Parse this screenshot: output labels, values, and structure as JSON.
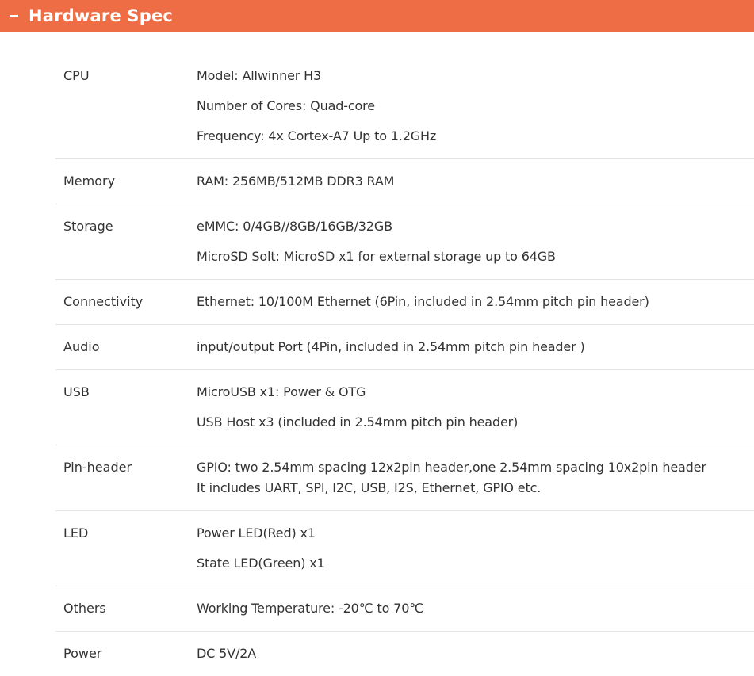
{
  "header": {
    "title": "Hardware Spec",
    "accent_color": "#ee6d44",
    "icon": "minus-icon"
  },
  "rows": [
    {
      "label": "CPU",
      "values": [
        "Model: Allwinner H3",
        "Number of Cores: Quad-core",
        "Frequency: 4x Cortex-A7 Up to 1.2GHz"
      ]
    },
    {
      "label": "Memory",
      "values": [
        "RAM: 256MB/512MB DDR3 RAM"
      ]
    },
    {
      "label": "Storage",
      "values": [
        "eMMC: 0/4GB//8GB/16GB/32GB",
        "MicroSD Solt: MicroSD x1 for external storage up to 64GB"
      ]
    },
    {
      "label": "Connectivity",
      "values": [
        "Ethernet: 10/100M Ethernet (6Pin, included in 2.54mm pitch pin header)"
      ]
    },
    {
      "label": "Audio",
      "values": [
        "input/output Port (4Pin, included in 2.54mm pitch pin header )"
      ]
    },
    {
      "label": "USB",
      "values": [
        "MicroUSB x1: Power & OTG",
        "USB Host x3 (included in 2.54mm pitch pin header)"
      ]
    },
    {
      "label": "Pin-header",
      "values": [
        "GPIO: two 2.54mm spacing 12x2pin header,one 2.54mm spacing 10x2pin header",
        "It includes UART, SPI, I2C, USB, I2S, Ethernet, GPIO etc."
      ]
    },
    {
      "label": "LED",
      "values": [
        "Power LED(Red) x1",
        "State LED(Green) x1"
      ]
    },
    {
      "label": "Others",
      "values": [
        "Working Temperature: -20℃ to 70℃"
      ]
    },
    {
      "label": "Power",
      "values": [
        "DC 5V/2A"
      ]
    }
  ]
}
